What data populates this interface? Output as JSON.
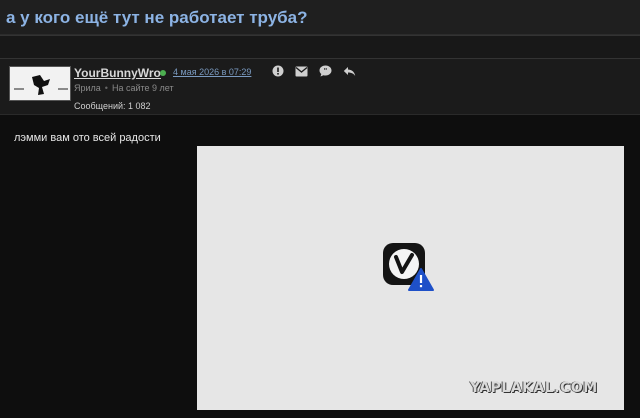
{
  "topic": {
    "title": "а у кого ещё тут не работает труба?"
  },
  "post": {
    "username": "YourBunnyWro",
    "date": "4 мая 2026 в 07:29",
    "user_rank": "Ярила",
    "separator": "•",
    "on_site": "На сайте 9 лет",
    "messages_label": "Сообщений: 1 082",
    "text": "лэмми вам ото всей радости",
    "online_color": "#4caf50"
  },
  "actions": [
    {
      "icon": "report-icon"
    },
    {
      "icon": "envelope-icon"
    },
    {
      "icon": "quote-icon"
    },
    {
      "icon": "reply-icon"
    }
  ],
  "embed": {
    "icon": "vivaldi-browser-icon",
    "badge": "warning-badge-icon"
  },
  "watermark": "YAPLAKAL.COM"
}
